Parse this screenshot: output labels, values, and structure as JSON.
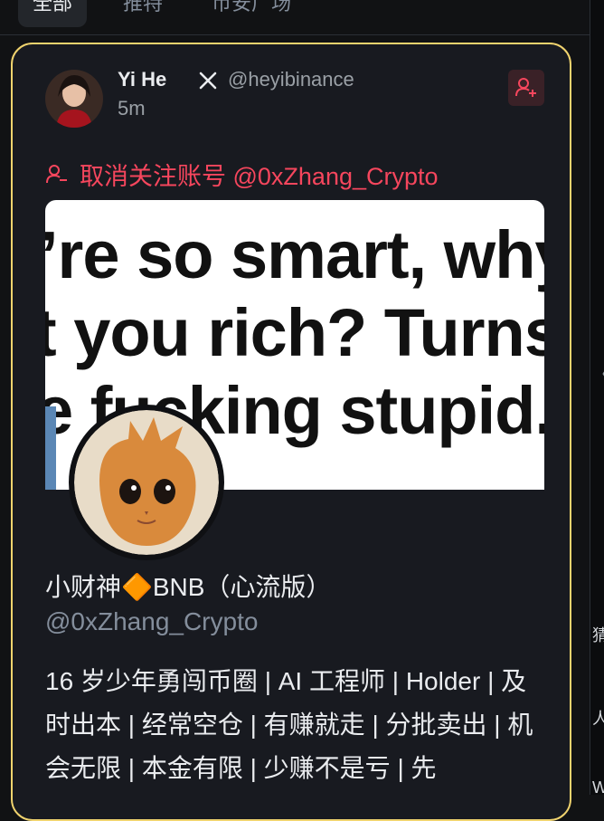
{
  "tabs": [
    "全部",
    "推特",
    "币安广场"
  ],
  "post": {
    "author_name": "Yi He",
    "author_handle": "@heyibinance",
    "time": "5m",
    "action": "取消关注账号 @0xZhang_Crypto",
    "media": {
      "lines": [
        "’re so smart, why",
        "t you rich? Turns",
        "e fucking stupid."
      ]
    },
    "profile": {
      "name": "小财神🔶BNB（心流版）",
      "handle": "@0xZhang_Crypto",
      "bio": "16 岁少年勇闯币圈 | AI 工程师 | Holder | 及时出本 | 经常空仓 | 有赚就走 | 分批卖出 | 机会无限 | 本金有限 | 少赚不是亏 | 先"
    }
  },
  "rail": {
    "chevron": "〈",
    "texts": [
      "猜",
      "人",
      "W"
    ]
  },
  "colors": {
    "accent": "#f0d36e",
    "danger": "#f6465d",
    "bg": "#111214"
  }
}
